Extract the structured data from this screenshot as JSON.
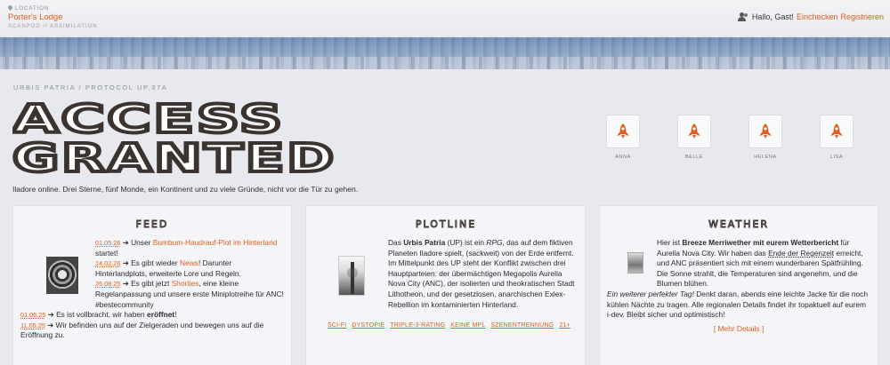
{
  "topbar": {
    "location_label": "LOCATION",
    "location_name": "Porter's Lodge",
    "location_sub": "SCANPOD // ASSIMILATION",
    "greeting": "Hallo, Gast!",
    "checkin_label": "Einchecken",
    "register_label": "Registrieren"
  },
  "hero": {
    "breadcrumb": "URBIS PATRIA / PROTOCOL UP.37A",
    "title_line1": "ACCESS",
    "title_line2": "GRANTED",
    "tagline": "Iladore online. Drei Sterne, fünf Monde, ein Kontinent und zu viele Gründe, nicht vor die Tür zu gehen."
  },
  "avatars": [
    {
      "name": "ANNA",
      "icon": "rocket-icon"
    },
    {
      "name": "BELLE",
      "icon": "rocket-icon"
    },
    {
      "name": "HELENA",
      "icon": "rocket-icon"
    },
    {
      "name": "LISA",
      "icon": "rocket-icon"
    }
  ],
  "feed": {
    "heading": "FEED",
    "items": [
      {
        "date": "01.05.26",
        "pre": "➔ Unser ",
        "link": "Bumbum-Haudrauf-Plot im Hinterland",
        "post": " startet!"
      },
      {
        "date": "14.02.26",
        "pre": "➔ Es gibt wieder ",
        "link": "News",
        "post": "! Darunter Hinterlandplots, erweiterte Lore und Regeln."
      },
      {
        "date": "26.08.25",
        "pre": "➔ Es gibt jetzt ",
        "link": "Shorties",
        "post": ", eine kleine Regelanpassung und unsere erste Miniplotreihe für ANC! #bestecommunity"
      },
      {
        "date": "01.06.25",
        "pre": "➔ Es ist vollbracht, wir haben ",
        "bold": "eröffnet",
        "post": "!"
      },
      {
        "date": "11.05.25",
        "pre": "➔ Wir befinden uns auf der Zielgeraden und bewegen uns auf die Eröffnung zu."
      }
    ]
  },
  "plotline": {
    "heading": "PLOTLINE",
    "t1": "Das ",
    "b1": "Urbis Patria",
    "t2": " (UP) ist ein ",
    "i1": "RPG",
    "t3": ", das auf dem fiktiven Planeten Iladore spielt, (sackweit) von der Erde entfernt. Im Mittelpunkt des UP steht der Konflikt zwischen drei Hauptparteien: der übermächtigen Megapolis Aurelia Nova City (ANC), der isolierten und theokratischen Stadt Lithotheon, und der gesetzlosen, anarchischen Exlex-Rebellion im kontaminierten Hinterland.",
    "tags": [
      "SCI-FI",
      "DYSTOPIE",
      "TRIPLE-3-RATING",
      "KEINE MPL",
      "SZENENTRENNUNG",
      "21+"
    ]
  },
  "weather": {
    "heading": "WEATHER",
    "t1": "Hier ist ",
    "b1": "Breeze Merriwether mit eurem Wetterbericht",
    "t2": " für Aurelia Nova City. Wir haben das ",
    "link": "Ende der Regenzeit",
    "t3": " erreicht, und ANC präsentiert sich mit einem wunderbaren Spätfrühling. Die Sonne strahlt, die Temperaturen sind angenehm, und die Blumen blühen. ",
    "i1": "Ein weiterer perfekter Tag!",
    "t4": " Denkt daran, abends eine leichte Jacke für die noch kühlen Nächte zu tragen. Alle regionalen Details findet ihr topaktuell auf eurem i-dev. Bleibt sicher und optimistisch!",
    "more": "[ Mehr Details ]"
  },
  "colors": {
    "accent": "#e0601c",
    "title": "#3b3330",
    "card_bg": "#f4f5f8"
  }
}
